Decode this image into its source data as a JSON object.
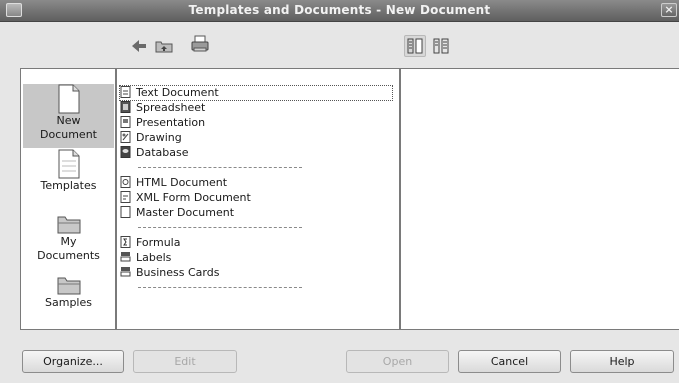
{
  "window": {
    "title": "Templates and Documents - New Document",
    "close_glyph": "×"
  },
  "toolbar": {
    "back_icon": "back-arrow-icon",
    "up_icon": "folder-up-icon",
    "print_icon": "printer-icon",
    "doc_preview_icon": "document-preview-toggle-icon",
    "doc_properties_icon": "document-properties-toggle-icon"
  },
  "nav": [
    {
      "label": "New\nDocument",
      "icon": "new-document-icon",
      "selected": true
    },
    {
      "label": "Templates",
      "icon": "templates-icon",
      "selected": false
    },
    {
      "label": "My\nDocuments",
      "icon": "folder-icon",
      "selected": false
    },
    {
      "label": "Samples",
      "icon": "folder-icon",
      "selected": false
    }
  ],
  "list": {
    "groups": [
      [
        "Text Document",
        "Spreadsheet",
        "Presentation",
        "Drawing",
        "Database"
      ],
      [
        "HTML Document",
        "XML Form Document",
        "Master Document"
      ],
      [
        "Formula",
        "Labels",
        "Business Cards"
      ]
    ],
    "separator_text": "----------------------------------------"
  },
  "buttons": {
    "organize": "Organize...",
    "edit": "Edit",
    "open": "Open",
    "cancel": "Cancel",
    "help": "Help"
  }
}
